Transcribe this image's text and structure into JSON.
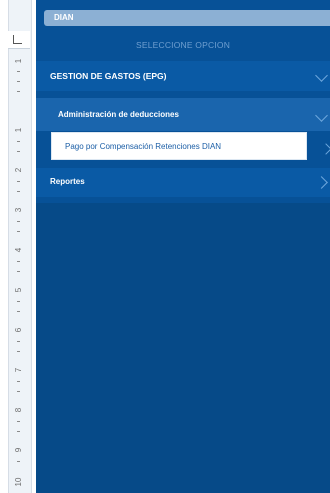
{
  "ruler": {
    "marks": [
      "L",
      "1",
      "1",
      "2",
      "3",
      "4",
      "5",
      "6",
      "7",
      "8",
      "9",
      "10"
    ]
  },
  "app": {
    "title": "DIAN",
    "subtitle": "SELECCIONE OPCION"
  },
  "menu": {
    "section": "GESTION DE GASTOS (EPG)",
    "group": "Administración de deducciones",
    "selected": "Pago por Compensación Retenciones DIAN",
    "reports": "Reportes"
  },
  "colors": {
    "panel": "#075197",
    "header_bar": "#8cb0d4",
    "selected_bg": "#ffffff",
    "selected_text": "#1b5ea6"
  },
  "icons": {
    "tab_marker": "tab-marker-icon",
    "down": "chevron-down-icon",
    "right": "chevron-right-icon"
  }
}
